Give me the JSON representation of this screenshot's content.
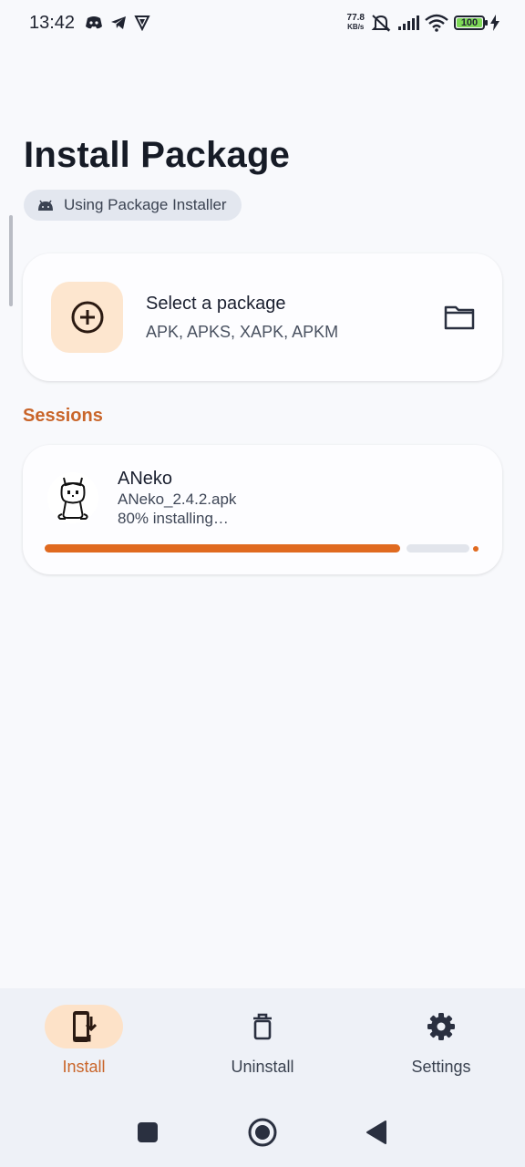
{
  "status_bar": {
    "time": "13:42",
    "speed_value": "77.8",
    "speed_unit": "KB/s",
    "battery": "100",
    "left_icons": [
      "discord-icon",
      "telegram-icon",
      "vpn-icon"
    ],
    "right_icons": [
      "mute-icon",
      "signal-icon",
      "wifi-icon",
      "battery-icon",
      "charging-icon"
    ]
  },
  "header": {
    "title": "Install Package",
    "installer_chip": "Using Package Installer"
  },
  "select_card": {
    "title": "Select a package",
    "subtitle": "APK, APKS, XAPK, APKM"
  },
  "sessions": {
    "title": "Sessions",
    "items": [
      {
        "app_name": "ANeko",
        "file_name": "ANeko_2.4.2.apk",
        "status": "80% installing…",
        "progress": 0.8
      }
    ]
  },
  "bottom_nav": {
    "items": [
      {
        "label": "Install",
        "icon": "install-icon",
        "active": true
      },
      {
        "label": "Uninstall",
        "icon": "trash-icon",
        "active": false
      },
      {
        "label": "Settings",
        "icon": "gear-icon",
        "active": false
      }
    ]
  },
  "colors": {
    "accent": "#c9652a",
    "progress": "#e06a20",
    "tile": "#fde6cf"
  }
}
